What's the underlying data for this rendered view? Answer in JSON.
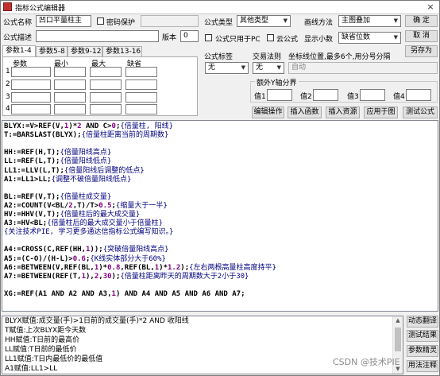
{
  "window": {
    "title": "指标公式编辑器",
    "close": "×"
  },
  "form": {
    "name_label": "公式名称",
    "name_value": "凹口平量柱主",
    "pwd_label": "密码保护",
    "desc_label": "公式描述",
    "desc_value": "",
    "version_label": "版本",
    "version_value": "0",
    "type_label": "公式类型",
    "type_value": "其他类型",
    "draw_label": "画线方法",
    "draw_value": "主图叠加",
    "pc_only_label": "公式只用于PC",
    "cloud_label": "云公式",
    "decimal_label": "显示小数",
    "decimal_value": "缺省位数",
    "tag_label": "公式标签",
    "tag_value": "无",
    "trade_label": "交易法则",
    "trade_value": "无",
    "coord_label": "坐标线位置,最多6个,用分号分隔",
    "coord_value": "自动",
    "extra_y_label": "额外Y轴分界",
    "values": [
      "值1",
      "值2",
      "值3",
      "值4"
    ]
  },
  "buttons": {
    "ok": "确 定",
    "cancel": "取 消",
    "saveas": "另存为",
    "edit": "编辑操作",
    "insert_fn": "插入函数",
    "insert_res": "插入资源",
    "apply": "应用于图",
    "test": "测试公式"
  },
  "tabs": [
    "参数1-4",
    "参数5-8",
    "参数9-12",
    "参数13-16"
  ],
  "params": {
    "headers": [
      "参数",
      "最小",
      "最大",
      "缺省"
    ],
    "rows": [
      "1",
      "2",
      "3",
      "4"
    ]
  },
  "code_lines": [
    [
      {
        "t": "BLYX:=V>",
        "c": "v"
      },
      {
        "t": "REF",
        "c": "fn"
      },
      {
        "t": "(V,",
        "c": "v"
      },
      {
        "t": "1",
        "c": "num"
      },
      {
        "t": ")*",
        "c": "v"
      },
      {
        "t": "2",
        "c": "num"
      },
      {
        "t": " AND ",
        "c": "kw"
      },
      {
        "t": "C>",
        "c": "v"
      },
      {
        "t": "0",
        "c": "num"
      },
      {
        "t": ";",
        "c": "v"
      },
      {
        "t": "{倍量柱, 阳线}",
        "c": "cm"
      }
    ],
    [
      {
        "t": "T:=",
        "c": "v"
      },
      {
        "t": "BARSLAST",
        "c": "fn"
      },
      {
        "t": "(BLYX);",
        "c": "v"
      },
      {
        "t": "{倍量柱距离当前的周期数}",
        "c": "cm"
      }
    ],
    [],
    [
      {
        "t": "HH:=",
        "c": "v"
      },
      {
        "t": "REF",
        "c": "fn"
      },
      {
        "t": "(H,T);",
        "c": "v"
      },
      {
        "t": "{倍量阳线高点}",
        "c": "cm"
      }
    ],
    [
      {
        "t": "LL:=",
        "c": "v"
      },
      {
        "t": "REF",
        "c": "fn"
      },
      {
        "t": "(L,T);",
        "c": "v"
      },
      {
        "t": "{倍量阳线低点}",
        "c": "cm"
      }
    ],
    [
      {
        "t": "LL1:=",
        "c": "v"
      },
      {
        "t": "LLV",
        "c": "fn"
      },
      {
        "t": "(L,T);",
        "c": "v"
      },
      {
        "t": "{倍量阳线后调整的低点}",
        "c": "cm"
      }
    ],
    [
      {
        "t": "A1:=LL1>LL;",
        "c": "v"
      },
      {
        "t": "{调整不破倍量阳线低点}",
        "c": "cm"
      }
    ],
    [],
    [
      {
        "t": "BL:=",
        "c": "v"
      },
      {
        "t": "REF",
        "c": "fn"
      },
      {
        "t": "(V,T);",
        "c": "v"
      },
      {
        "t": "{倍量柱成交量}",
        "c": "cm"
      }
    ],
    [
      {
        "t": "A2:=",
        "c": "v"
      },
      {
        "t": "COUNT",
        "c": "fn"
      },
      {
        "t": "(V<BL/",
        "c": "v"
      },
      {
        "t": "2",
        "c": "num"
      },
      {
        "t": ",T)/T>",
        "c": "v"
      },
      {
        "t": "0.5",
        "c": "num"
      },
      {
        "t": ";",
        "c": "v"
      },
      {
        "t": "{缩量大于一半}",
        "c": "cm"
      }
    ],
    [
      {
        "t": "HV:=",
        "c": "v"
      },
      {
        "t": "HHV",
        "c": "fn"
      },
      {
        "t": "(V,T);",
        "c": "v"
      },
      {
        "t": "{倍量柱后的最大成交量}",
        "c": "cm"
      }
    ],
    [
      {
        "t": "A3:=HV<BL;",
        "c": "v"
      },
      {
        "t": "{倍量柱后的最大成交量小于倍量柱}",
        "c": "cm"
      }
    ],
    [
      {
        "t": "{关注技术PIE, 学习更多通达信指标公式编写知识。}",
        "c": "cm"
      }
    ],
    [],
    [
      {
        "t": "A4:=",
        "c": "v"
      },
      {
        "t": "CROSS",
        "c": "fn"
      },
      {
        "t": "(C,",
        "c": "v"
      },
      {
        "t": "REF",
        "c": "fn"
      },
      {
        "t": "(HH,",
        "c": "v"
      },
      {
        "t": "1",
        "c": "num"
      },
      {
        "t": "));",
        "c": "v"
      },
      {
        "t": "{突破倍量阳线高点}",
        "c": "cm"
      }
    ],
    [
      {
        "t": "A5:=(C-O)/(H-L)>",
        "c": "v"
      },
      {
        "t": "0.6",
        "c": "num"
      },
      {
        "t": ";",
        "c": "v"
      },
      {
        "t": "{K线实体部分大于60%}",
        "c": "cm"
      }
    ],
    [
      {
        "t": "A6:=",
        "c": "v"
      },
      {
        "t": "BETWEEN",
        "c": "fn"
      },
      {
        "t": "(V,",
        "c": "v"
      },
      {
        "t": "REF",
        "c": "fn"
      },
      {
        "t": "(BL,",
        "c": "v"
      },
      {
        "t": "1",
        "c": "num"
      },
      {
        "t": ")*",
        "c": "v"
      },
      {
        "t": "0.8",
        "c": "num"
      },
      {
        "t": ",",
        "c": "v"
      },
      {
        "t": "REF",
        "c": "fn"
      },
      {
        "t": "(BL,",
        "c": "v"
      },
      {
        "t": "1",
        "c": "num"
      },
      {
        "t": ")*",
        "c": "v"
      },
      {
        "t": "1.2",
        "c": "num"
      },
      {
        "t": ");",
        "c": "v"
      },
      {
        "t": "{左右两根高量柱高度持平}",
        "c": "cm"
      }
    ],
    [
      {
        "t": "A7:=",
        "c": "v"
      },
      {
        "t": "BETWEEN",
        "c": "fn"
      },
      {
        "t": "(",
        "c": "v"
      },
      {
        "t": "REF",
        "c": "fn"
      },
      {
        "t": "(T,",
        "c": "v"
      },
      {
        "t": "1",
        "c": "num"
      },
      {
        "t": "),",
        "c": "v"
      },
      {
        "t": "2",
        "c": "num"
      },
      {
        "t": ",",
        "c": "v"
      },
      {
        "t": "30",
        "c": "num"
      },
      {
        "t": ");",
        "c": "v"
      },
      {
        "t": "{倍量柱距离昨天的周期数大于2小于30}",
        "c": "cm"
      }
    ],
    [],
    [
      {
        "t": "XG:=",
        "c": "v"
      },
      {
        "t": "REF",
        "c": "fn"
      },
      {
        "t": "(A1",
        "c": "v"
      },
      {
        "t": " AND ",
        "c": "kw"
      },
      {
        "t": "A2",
        "c": "v"
      },
      {
        "t": " AND ",
        "c": "kw"
      },
      {
        "t": "A3,",
        "c": "v"
      },
      {
        "t": "1",
        "c": "num"
      },
      {
        "t": ")",
        "c": "v"
      },
      {
        "t": " AND ",
        "c": "kw"
      },
      {
        "t": "A4",
        "c": "v"
      },
      {
        "t": " AND ",
        "c": "kw"
      },
      {
        "t": "A5",
        "c": "v"
      },
      {
        "t": " AND ",
        "c": "kw"
      },
      {
        "t": "A6",
        "c": "v"
      },
      {
        "t": " AND ",
        "c": "kw"
      },
      {
        "t": "A7;",
        "c": "v"
      }
    ]
  ],
  "output_lines": [
    "BLYX赋值:成交量(手)>1日前的成交量(手)*2 AND 收阳线",
    "T赋值:上次BLYX距今天数",
    "HH赋值:T日前的最高价",
    "LL赋值:T日前的最低价",
    "LL1赋值:T日内最低价的最低值",
    "A1赋值:LL1>LL"
  ],
  "side_buttons": [
    "动态翻译",
    "测试结果",
    "参数精灵",
    "用法注释"
  ],
  "watermark": "CSDN @技术PIE"
}
